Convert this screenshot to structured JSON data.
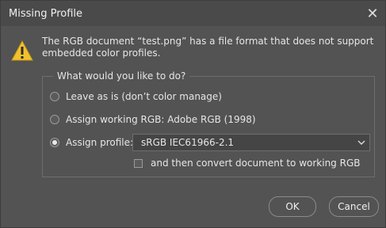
{
  "window": {
    "title": "Missing Profile",
    "close_glyph": "✕"
  },
  "message": {
    "icon": "warning-icon",
    "text": "The RGB document “test.png” has a file format that does not support embedded color profiles."
  },
  "group": {
    "legend": "What would you like to do?",
    "options": [
      {
        "label": "Leave as is (don’t color manage)",
        "selected": false
      },
      {
        "label": "Assign working RGB:  Adobe RGB (1998)",
        "selected": false
      },
      {
        "label": "Assign profile:",
        "selected": true
      }
    ],
    "profile_select": {
      "value": "sRGB IEC61966-2.1"
    },
    "convert_checkbox": {
      "label": "and then convert document to working RGB",
      "checked": false
    }
  },
  "buttons": {
    "ok": "OK",
    "cancel": "Cancel"
  },
  "colors": {
    "background": "#535353",
    "warning": "#f2c12e"
  }
}
